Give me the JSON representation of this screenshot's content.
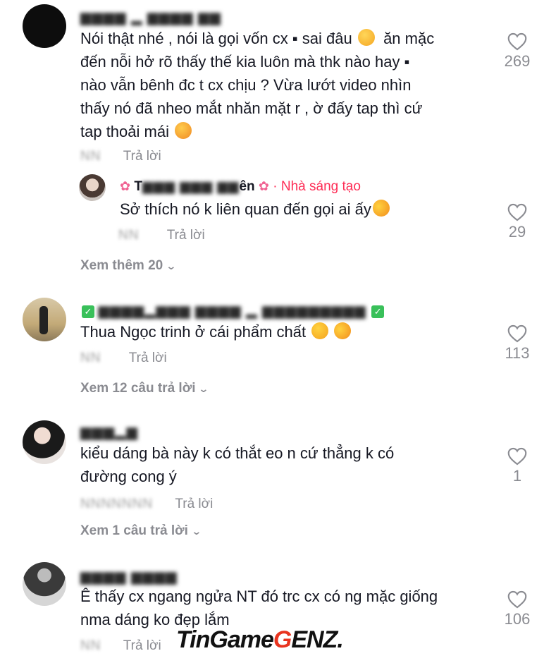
{
  "comments": [
    {
      "username": "NNNN NN NNNN NNN",
      "text": "Nói thật nhé , nói là gọi vốn cx ▪ sai đâu 😔 ăn mặc đến nỗi hở rõ thấy thế kia luôn mà thhk nào hay ▪ nào vẫn bênh đc t cx chịu ? Vừa lướt video nhìn thấy nó đã nheo mắt nhăn mặt r , ờ đấy tap thì cứ tap thoải mái 😚",
      "lines": [
        "Nói thật nhé , nói là gọi vốn cx ▪ sai đâu",
        "đến nỗi hở rõ thấy thế kia luôn mà thk nào hay ▪",
        "nào vẫn bênh đc t cx chịu ? Vừa lướt video nhìn",
        "thấy nó đã nheo mắt nhăn mặt r , ờ đấy tap thì cứ",
        "tap thoải mái"
      ],
      "line1_tail": "ăn mặc",
      "date": "NN",
      "reply_label": "Trả lời",
      "likes": "269"
    }
  ],
  "reply": {
    "username_visible": "T",
    "username_tail": "ên",
    "creator_label": "· Nhà sáng tạo",
    "text": "Sở thích nó k liên quan đến gọi ai ấy",
    "date": "NN",
    "reply_label": "Trả lời",
    "likes": "29"
  },
  "view_more_1": "Xem thêm 20",
  "c2": {
    "text": "Thua Ngọc trinh ở cái phẩm chất",
    "date": "NN",
    "reply_label": "Trả lời",
    "likes": "113",
    "view_replies": "Xem 12 câu trả lời"
  },
  "c3": {
    "line1": "kiểu dáng bà này k có thắt eo n cứ thẳng k có",
    "line2": "đường cong ý",
    "date": "NNNNNNN",
    "reply_label": "Trả lời",
    "likes": "1",
    "view_replies": "Xem 1 câu trả lời"
  },
  "c4": {
    "line1": "Ê thấy cx ngang ngửa NT đó trc cx có ng mặc giống",
    "line2": "nma dáng ko đẹp lắm",
    "date": "NN",
    "reply_label": "Trả lời",
    "likes": "106"
  },
  "watermark": {
    "part1": "TinGame",
    "part2": "G",
    "part3": "ENZ."
  },
  "colors": {
    "text": "#161823",
    "muted": "#8a8b91",
    "creator": "#fe2c55"
  }
}
